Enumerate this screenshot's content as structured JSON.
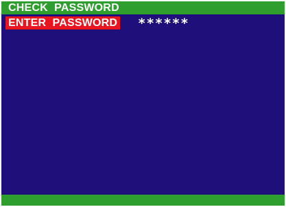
{
  "title": "CHECK  PASSWORD",
  "password_field": {
    "label": "ENTER  PASSWORD",
    "value": "******"
  },
  "colors": {
    "background": "#1f0f7a",
    "bar": "#2e9e2e",
    "label_highlight": "#e8141e",
    "text": "#ffffff"
  }
}
